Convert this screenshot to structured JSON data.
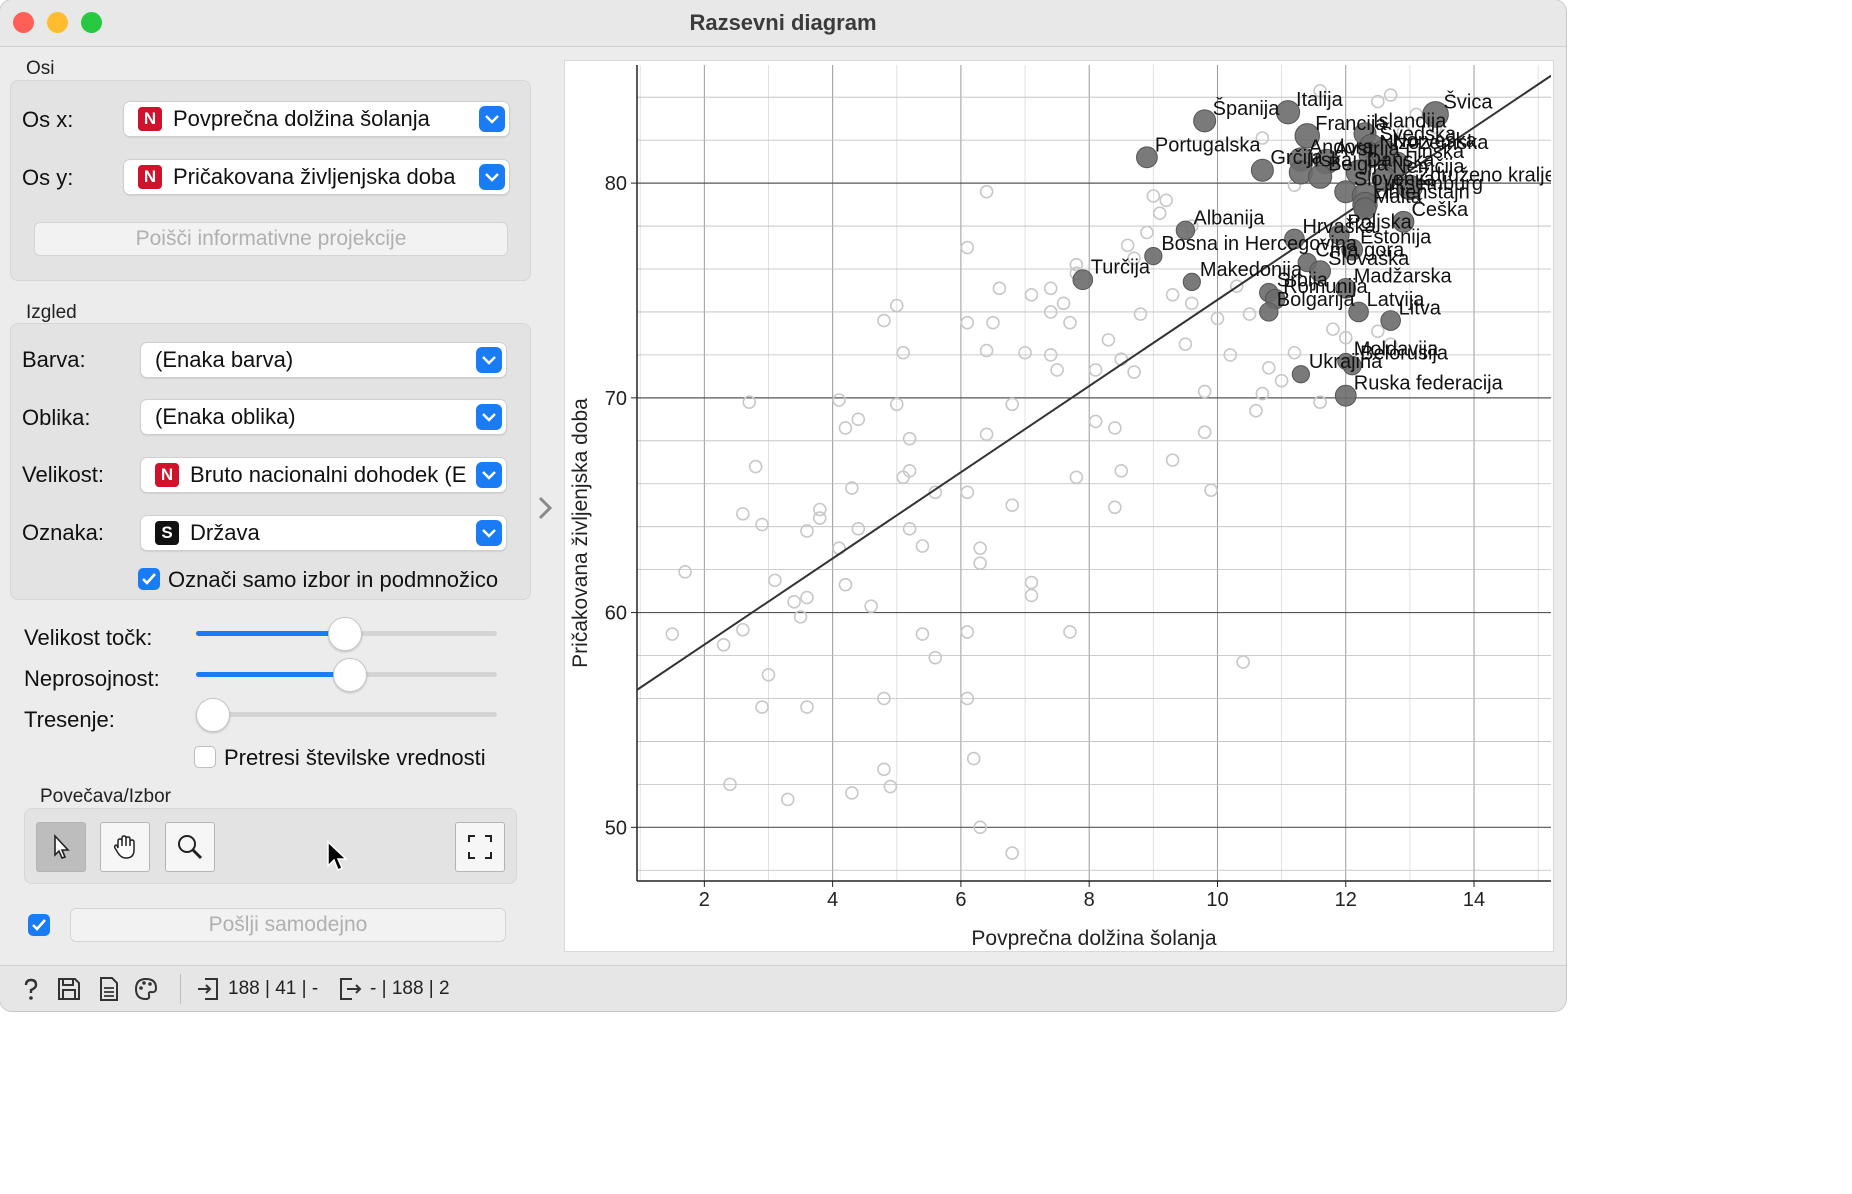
{
  "window": {
    "title": "Razsevni diagram"
  },
  "axes_group": {
    "label": "Osi",
    "x_label": "Os x:",
    "x_value": "Povprečna dolžina šolanja",
    "x_badge": "N",
    "y_label": "Os y:",
    "y_value": "Pričakovana življenjska doba",
    "y_badge": "N",
    "find_button": "Poišči informativne projekcije"
  },
  "appearance_group": {
    "label": "Izgled",
    "color_label": "Barva:",
    "color_value": "(Enaka barva)",
    "shape_label": "Oblika:",
    "shape_value": "(Enaka oblika)",
    "size_label": "Velikost:",
    "size_value": "Bruto nacionalni dohodek (E",
    "size_badge": "N",
    "label_label": "Oznaka:",
    "label_value": "Država",
    "label_badge": "S",
    "label_selected_only": "Označi samo izbor in podmnožico",
    "label_selected_only_checked": true
  },
  "sliders": {
    "point_size_label": "Velikost točk:",
    "point_size_value": 0.49,
    "opacity_label": "Neprosojnost:",
    "opacity_value": 0.51,
    "jitter_label": "Tresenje:",
    "jitter_value": 0.0,
    "jitter_numeric_label": "Pretresi številske vrednosti",
    "jitter_numeric_checked": false
  },
  "zoom_group": {
    "label": "Povečava/Izbor",
    "tools": [
      "pointer-icon",
      "hand-icon",
      "magnifier-icon",
      "fit-icon"
    ]
  },
  "send": {
    "auto_checked": true,
    "button": "Pošlji samodejno"
  },
  "status": {
    "input_summary": "188 | 41 | -",
    "output_summary": "- | 188 | 2"
  },
  "chart_data": {
    "type": "scatter",
    "xlabel": "Povprečna dolžina šolanja",
    "ylabel": "Pričakovana življenjska doba",
    "xlim": [
      0.95,
      15.2
    ],
    "ylim": [
      47.5,
      85.5
    ],
    "xticks": [
      2,
      4,
      6,
      8,
      10,
      12,
      14
    ],
    "yticks": [
      50,
      60,
      70,
      80
    ],
    "grid": true,
    "regression_line": [
      [
        0.95,
        56.4
      ],
      [
        15.2,
        85.0
      ]
    ],
    "labeled_points": [
      {
        "x": 9.8,
        "y": 82.9,
        "label": "Španija",
        "size": 1.0
      },
      {
        "x": 11.1,
        "y": 83.3,
        "label": "Italija",
        "size": 1.1
      },
      {
        "x": 13.4,
        "y": 83.2,
        "label": "Švica",
        "size": 1.3
      },
      {
        "x": 12.3,
        "y": 82.3,
        "label": "Islandija",
        "size": 1.0
      },
      {
        "x": 11.4,
        "y": 82.2,
        "label": "Francija",
        "size": 1.2
      },
      {
        "x": 12.4,
        "y": 81.7,
        "label": "Švedska",
        "size": 1.2
      },
      {
        "x": 11.3,
        "y": 81.1,
        "label": "Andora",
        "size": 1.1
      },
      {
        "x": 11.7,
        "y": 81.0,
        "label": "Avstrija",
        "size": 1.2
      },
      {
        "x": 12.4,
        "y": 81.3,
        "label": "Nizozemska",
        "size": 1.2
      },
      {
        "x": 12.8,
        "y": 80.9,
        "label": "Finska",
        "size": 1.1
      },
      {
        "x": 12.6,
        "y": 81.4,
        "label": "Norveška",
        "size": 1.3
      },
      {
        "x": 8.9,
        "y": 81.2,
        "label": "Portugalska",
        "size": 0.9
      },
      {
        "x": 10.7,
        "y": 80.6,
        "label": "Grčija",
        "size": 1.0
      },
      {
        "x": 11.3,
        "y": 80.5,
        "label": "Irska",
        "size": 1.1
      },
      {
        "x": 11.6,
        "y": 80.3,
        "label": "Belgija",
        "size": 1.1
      },
      {
        "x": 12.2,
        "y": 80.5,
        "label": "Danska",
        "size": 1.2
      },
      {
        "x": 12.6,
        "y": 80.2,
        "label": "Nemčija",
        "size": 1.2
      },
      {
        "x": 13.0,
        "y": 79.8,
        "label": "Združeno kraljestvo",
        "size": 1.2
      },
      {
        "x": 12.0,
        "y": 79.6,
        "label": "Slovenija",
        "size": 1.0
      },
      {
        "x": 12.3,
        "y": 79.4,
        "label": "Luksemburg",
        "size": 1.3
      },
      {
        "x": 12.3,
        "y": 79.0,
        "label": "Lihtenštajn",
        "size": 1.2
      },
      {
        "x": 12.3,
        "y": 78.8,
        "label": "Malta",
        "size": 1.0
      },
      {
        "x": 12.9,
        "y": 78.2,
        "label": "Češka",
        "size": 0.9
      },
      {
        "x": 9.5,
        "y": 77.8,
        "label": "Albanija",
        "size": 0.7
      },
      {
        "x": 11.2,
        "y": 77.4,
        "label": "Hrvaška",
        "size": 0.8
      },
      {
        "x": 11.9,
        "y": 77.6,
        "label": "Poljska",
        "size": 0.8
      },
      {
        "x": 12.1,
        "y": 76.9,
        "label": "Estonija",
        "size": 0.9
      },
      {
        "x": 9.0,
        "y": 76.6,
        "label": "Bosna in Hercegovina",
        "size": 0.6
      },
      {
        "x": 11.4,
        "y": 76.3,
        "label": "Črna gora",
        "size": 0.7
      },
      {
        "x": 11.6,
        "y": 75.9,
        "label": "Slovaška",
        "size": 0.9
      },
      {
        "x": 7.9,
        "y": 75.5,
        "label": "Turčija",
        "size": 0.8
      },
      {
        "x": 9.6,
        "y": 75.4,
        "label": "Makedonija",
        "size": 0.6
      },
      {
        "x": 12.0,
        "y": 75.1,
        "label": "Madžarska",
        "size": 0.8
      },
      {
        "x": 10.8,
        "y": 74.9,
        "label": "Srbija",
        "size": 0.7
      },
      {
        "x": 10.9,
        "y": 74.6,
        "label": "Romunija",
        "size": 0.8
      },
      {
        "x": 10.8,
        "y": 74.0,
        "label": "Bolgarija",
        "size": 0.7
      },
      {
        "x": 12.2,
        "y": 74.0,
        "label": "Latvija",
        "size": 0.8
      },
      {
        "x": 12.7,
        "y": 73.6,
        "label": "Litva",
        "size": 0.8
      },
      {
        "x": 12.0,
        "y": 71.7,
        "label": "Moldavija",
        "size": 0.5
      },
      {
        "x": 12.1,
        "y": 71.5,
        "label": "Belorusija",
        "size": 0.7
      },
      {
        "x": 11.3,
        "y": 71.1,
        "label": "Ukrajina",
        "size": 0.6
      },
      {
        "x": 12.0,
        "y": 70.1,
        "label": "Ruska federacija",
        "size": 0.9
      }
    ],
    "other_points": [
      [
        1.5,
        59.0
      ],
      [
        1.7,
        61.9
      ],
      [
        2.3,
        58.5
      ],
      [
        2.6,
        64.6
      ],
      [
        2.6,
        59.2
      ],
      [
        2.4,
        52.0
      ],
      [
        2.8,
        66.8
      ],
      [
        2.9,
        64.1
      ],
      [
        3.0,
        57.1
      ],
      [
        2.9,
        55.6
      ],
      [
        2.7,
        69.8
      ],
      [
        3.1,
        61.5
      ],
      [
        3.4,
        60.5
      ],
      [
        3.6,
        60.7
      ],
      [
        3.5,
        59.8
      ],
      [
        3.3,
        51.3
      ],
      [
        3.6,
        55.6
      ],
      [
        3.6,
        63.8
      ],
      [
        3.8,
        64.4
      ],
      [
        3.8,
        64.8
      ],
      [
        4.1,
        63.0
      ],
      [
        4.2,
        61.3
      ],
      [
        4.1,
        69.9
      ],
      [
        4.2,
        68.6
      ],
      [
        4.4,
        69.0
      ],
      [
        4.3,
        65.8
      ],
      [
        4.4,
        63.9
      ],
      [
        4.6,
        60.3
      ],
      [
        4.3,
        51.6
      ],
      [
        4.8,
        56.0
      ],
      [
        4.8,
        52.7
      ],
      [
        4.9,
        51.9
      ],
      [
        4.8,
        73.6
      ],
      [
        5.0,
        74.3
      ],
      [
        5.0,
        69.7
      ],
      [
        5.1,
        72.1
      ],
      [
        5.2,
        68.1
      ],
      [
        5.1,
        66.3
      ],
      [
        5.2,
        66.6
      ],
      [
        5.2,
        63.9
      ],
      [
        5.4,
        63.1
      ],
      [
        5.4,
        59.0
      ],
      [
        5.6,
        57.9
      ],
      [
        5.6,
        65.6
      ],
      [
        6.1,
        65.6
      ],
      [
        6.1,
        59.1
      ],
      [
        6.2,
        53.2
      ],
      [
        6.1,
        56.0
      ],
      [
        6.3,
        50.0
      ],
      [
        6.1,
        77.0
      ],
      [
        6.1,
        73.5
      ],
      [
        6.4,
        72.2
      ],
      [
        6.4,
        68.3
      ],
      [
        6.3,
        63.0
      ],
      [
        6.3,
        62.3
      ],
      [
        6.5,
        73.5
      ],
      [
        6.6,
        75.1
      ],
      [
        6.8,
        69.7
      ],
      [
        6.8,
        65.0
      ],
      [
        6.8,
        48.8
      ],
      [
        7.0,
        72.1
      ],
      [
        7.1,
        61.4
      ],
      [
        7.1,
        60.8
      ],
      [
        7.1,
        74.8
      ],
      [
        7.4,
        72.0
      ],
      [
        7.5,
        71.3
      ],
      [
        7.4,
        75.1
      ],
      [
        7.6,
        74.4
      ],
      [
        7.4,
        74.0
      ],
      [
        7.7,
        73.5
      ],
      [
        7.7,
        59.1
      ],
      [
        7.8,
        75.8
      ],
      [
        7.8,
        76.2
      ],
      [
        7.8,
        66.3
      ],
      [
        8.1,
        71.3
      ],
      [
        8.1,
        68.9
      ],
      [
        8.3,
        72.7
      ],
      [
        8.4,
        68.6
      ],
      [
        8.5,
        71.8
      ],
      [
        8.5,
        66.6
      ],
      [
        8.4,
        64.9
      ],
      [
        8.6,
        77.1
      ],
      [
        8.7,
        76.5
      ],
      [
        8.9,
        77.7
      ],
      [
        9.0,
        79.4
      ],
      [
        9.2,
        79.2
      ],
      [
        9.3,
        74.8
      ],
      [
        9.5,
        72.5
      ],
      [
        9.3,
        67.1
      ],
      [
        9.6,
        74.4
      ],
      [
        9.8,
        70.3
      ],
      [
        9.8,
        68.4
      ],
      [
        9.9,
        65.7
      ],
      [
        10.0,
        73.7
      ],
      [
        10.2,
        72.0
      ],
      [
        10.3,
        75.2
      ],
      [
        10.5,
        73.9
      ],
      [
        10.4,
        57.7
      ],
      [
        10.6,
        69.4
      ],
      [
        10.7,
        70.2
      ],
      [
        10.8,
        71.4
      ],
      [
        11.0,
        70.8
      ],
      [
        11.2,
        72.1
      ],
      [
        11.6,
        69.8
      ],
      [
        11.8,
        73.2
      ],
      [
        12.0,
        72.8
      ],
      [
        12.5,
        73.1
      ],
      [
        12.7,
        72.5
      ],
      [
        8.8,
        73.9
      ],
      [
        8.7,
        71.2
      ],
      [
        9.6,
        78.0
      ],
      [
        9.1,
        78.6
      ],
      [
        10.7,
        82.1
      ],
      [
        11.6,
        84.3
      ],
      [
        12.5,
        83.8
      ],
      [
        12.9,
        82.4
      ],
      [
        13.1,
        83.2
      ],
      [
        12.7,
        84.1
      ],
      [
        13.4,
        82.6
      ],
      [
        11.8,
        80.9
      ],
      [
        11.2,
        79.9
      ],
      [
        6.4,
        79.6
      ]
    ]
  }
}
